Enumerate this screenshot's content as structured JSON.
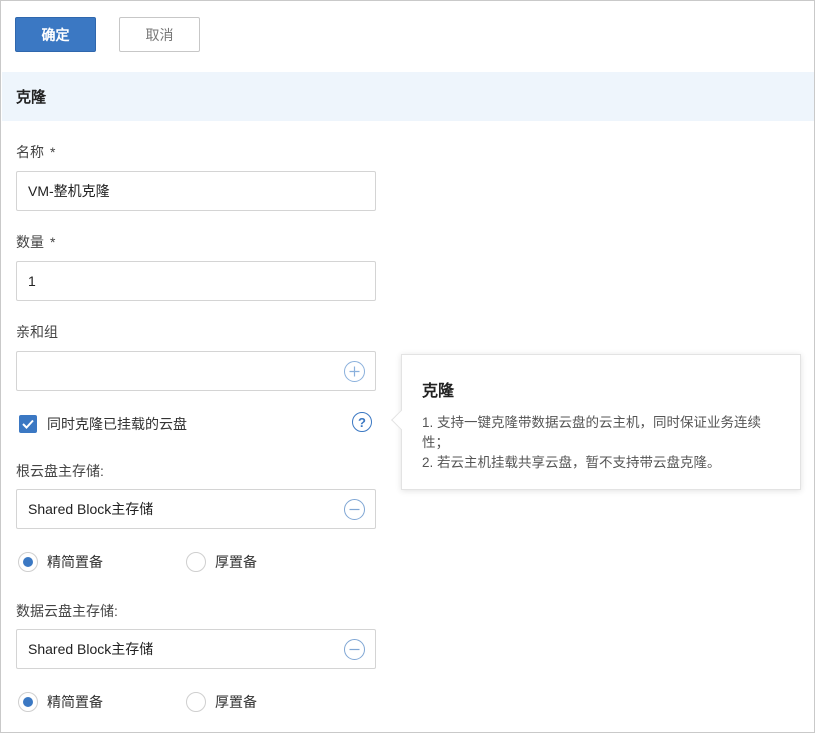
{
  "toolbar": {
    "confirm_label": "确定",
    "cancel_label": "取消"
  },
  "section": {
    "title": "克隆"
  },
  "fields": {
    "name": {
      "label": "名称",
      "required_mark": "*",
      "value": "VM-整机克隆"
    },
    "count": {
      "label": "数量",
      "required_mark": "*",
      "value": "1"
    },
    "affinity_group": {
      "label": "亲和组",
      "value": "",
      "icon": "plus-circle-icon"
    },
    "clone_disks": {
      "label": "同时克隆已挂载的云盘",
      "checked": true,
      "help_icon": "?"
    },
    "root_storage": {
      "label": "根云盘主存储:",
      "value": "Shared Block主存储",
      "icon": "minus-circle-icon",
      "provisioning": {
        "options": [
          "精简置备",
          "厚置备"
        ],
        "selected": "精简置备"
      }
    },
    "data_storage": {
      "label": "数据云盘主存储:",
      "value": "Shared Block主存储",
      "icon": "minus-circle-icon",
      "provisioning": {
        "options": [
          "精简置备",
          "厚置备"
        ],
        "selected": "精简置备"
      }
    }
  },
  "tooltip": {
    "title": "克隆",
    "line1": "1. 支持一键克隆带数据云盘的云主机，同时保证业务连续性；",
    "line2": "2. 若云主机挂载共享云盘，暂不支持带云盘克隆。"
  },
  "colors": {
    "accent": "#3b78c3",
    "header_bg": "#eef5fc"
  }
}
